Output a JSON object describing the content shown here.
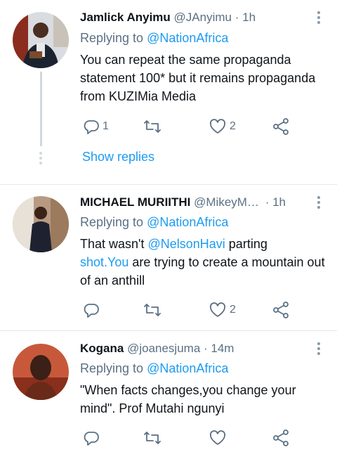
{
  "tweets": [
    {
      "name": "Jamlick Anyimu",
      "handle": "@JAnyimu",
      "time": "· 1h",
      "replying_prefix": "Replying to ",
      "replying_to": "@NationAfrica",
      "text": "You can repeat the same propaganda statement 100* but it remains propaganda from KUZIMia Media",
      "replies": "1",
      "retweets": "",
      "likes": "2"
    },
    {
      "name": "MICHAEL MURIITHI",
      "handle": "@MikeyM…",
      "time": "· 1h",
      "replying_prefix": "Replying to ",
      "replying_to": "@NationAfrica",
      "text_before": "That wasn't ",
      "text_mention": "@NelsonHavi",
      "text_middle": " parting ",
      "text_link": "shot.You",
      "text_after": " are trying to create a mountain out of an anthill",
      "replies": "",
      "retweets": "",
      "likes": "2"
    },
    {
      "name": "Kogana",
      "handle": "@joanesjuma",
      "time": "· 14m",
      "replying_prefix": "Replying to ",
      "replying_to": "@NationAfrica",
      "text": "\"When facts changes,you change your mind\". Prof Mutahi ngunyi",
      "replies": "",
      "retweets": "",
      "likes": ""
    }
  ],
  "show_replies": "Show replies",
  "colors": {
    "accent": "#1d9bf0",
    "muted": "#5b7083",
    "divider": "#e1e8ed"
  }
}
